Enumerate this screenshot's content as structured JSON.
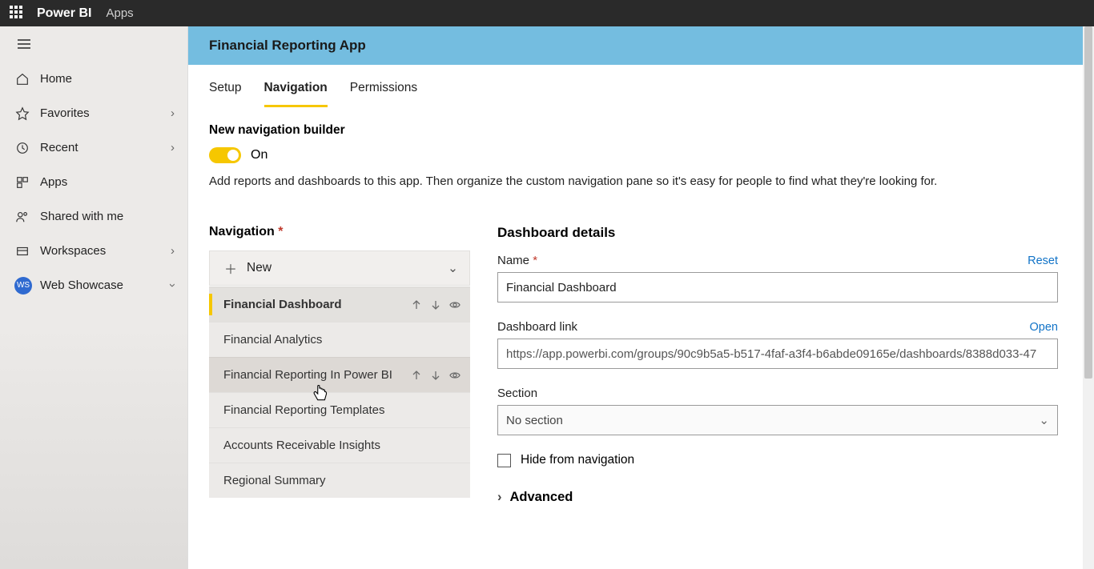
{
  "topbar": {
    "brand": "Power BI",
    "crumb": "Apps"
  },
  "sidebar": {
    "items": [
      {
        "label": "Home"
      },
      {
        "label": "Favorites",
        "chevron": true
      },
      {
        "label": "Recent",
        "chevron": true
      },
      {
        "label": "Apps"
      },
      {
        "label": "Shared with me"
      },
      {
        "label": "Workspaces",
        "chevron": true
      }
    ],
    "workspace_badge": "WS",
    "workspace_label": "Web Showcase"
  },
  "header": {
    "title": "Financial Reporting App"
  },
  "tabs": [
    {
      "label": "Setup"
    },
    {
      "label": "Navigation",
      "active": true
    },
    {
      "label": "Permissions"
    }
  ],
  "builder": {
    "title": "New navigation builder",
    "toggle_label": "On",
    "description": "Add reports and dashboards to this app. Then organize the custom navigation pane so it's easy for people to find what they're looking for."
  },
  "navlist": {
    "heading": "Navigation",
    "new_label": "New",
    "items": [
      {
        "label": "Financial Dashboard",
        "selected": true,
        "actions": true
      },
      {
        "label": "Financial Analytics"
      },
      {
        "label": "Financial Reporting In Power BI",
        "actions": true,
        "hover": true
      },
      {
        "label": "Financial Reporting Templates"
      },
      {
        "label": "Accounts Receivable Insights"
      },
      {
        "label": "Regional Summary"
      }
    ]
  },
  "details": {
    "heading": "Dashboard details",
    "name_label": "Name",
    "name_reset": "Reset",
    "name_value": "Financial Dashboard",
    "link_label": "Dashboard link",
    "link_open": "Open",
    "link_value": "https://app.powerbi.com/groups/90c9b5a5-b517-4faf-a3f4-b6abde09165e/dashboards/8388d033-47",
    "section_label": "Section",
    "section_value": "No section",
    "hide_label": "Hide from navigation",
    "advanced_label": "Advanced"
  }
}
